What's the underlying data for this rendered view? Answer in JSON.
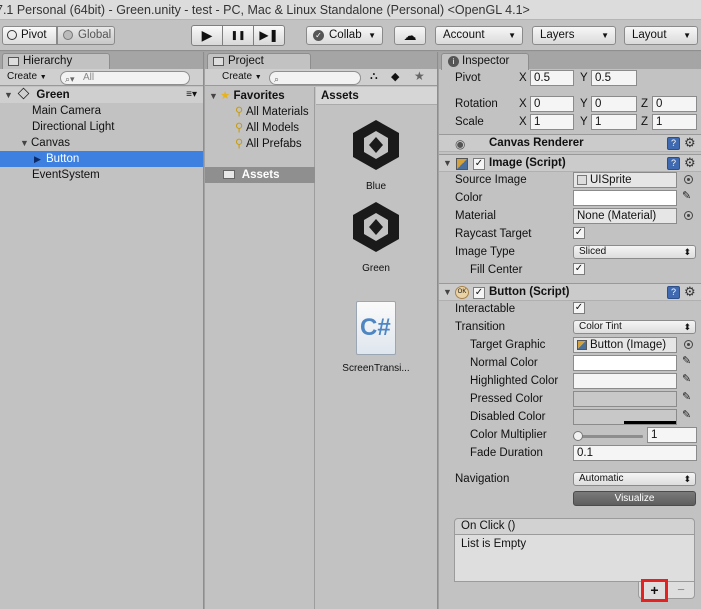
{
  "window": {
    "title": "7.1 Personal (64bit) - Green.unity - test - PC, Mac & Linux Standalone (Personal) <OpenGL 4.1>"
  },
  "toolbar": {
    "pivot": "Pivot",
    "global": "Global",
    "play": "▶",
    "pause": "❚❚",
    "step": "▶❚",
    "collab": "Collab",
    "cloud": "☁",
    "account": "Account",
    "layers": "Layers",
    "layout": "Layout"
  },
  "hierarchy": {
    "tab": "Hierarchy",
    "create": "Create",
    "search_placeholder": "All",
    "scene": "Green",
    "items": [
      {
        "label": "Main Camera"
      },
      {
        "label": "Directional Light"
      },
      {
        "label": "Canvas"
      },
      {
        "label": "Button"
      },
      {
        "label": "EventSystem"
      }
    ]
  },
  "project": {
    "tab": "Project",
    "create": "Create",
    "favorites": "Favorites",
    "fav_items": [
      "All Materials",
      "All Models",
      "All Prefabs"
    ],
    "assets_folder": "Assets",
    "assets_header": "Assets",
    "assets": [
      {
        "label": "Blue",
        "icon": "unity-logo-icon"
      },
      {
        "label": "Green",
        "icon": "unity-logo-icon"
      },
      {
        "label": "ScreenTransi...",
        "icon": "csharp-script-icon"
      }
    ]
  },
  "inspector": {
    "tab": "Inspector",
    "pivot": {
      "label": "Pivot",
      "x": "0.5",
      "y": "0.5"
    },
    "rotation": {
      "label": "Rotation",
      "x": "0",
      "y": "0",
      "z": "0"
    },
    "scale": {
      "label": "Scale",
      "x": "1",
      "y": "1",
      "z": "1"
    },
    "axis": {
      "x": "X",
      "y": "Y",
      "z": "Z"
    },
    "canvas_renderer": "Canvas Renderer",
    "image": {
      "title": "Image (Script)",
      "source_image_label": "Source Image",
      "source_image_value": "UISprite",
      "color_label": "Color",
      "material_label": "Material",
      "material_value": "None (Material)",
      "raycast_label": "Raycast Target",
      "image_type_label": "Image Type",
      "image_type_value": "Sliced",
      "fill_center_label": "Fill Center"
    },
    "button": {
      "title": "Button (Script)",
      "interactable_label": "Interactable",
      "transition_label": "Transition",
      "transition_value": "Color Tint",
      "target_graphic_label": "Target Graphic",
      "target_graphic_value": "Button (Image)",
      "normal_color_label": "Normal Color",
      "highlighted_color_label": "Highlighted Color",
      "pressed_color_label": "Pressed Color",
      "disabled_color_label": "Disabled Color",
      "color_multiplier_label": "Color Multiplier",
      "color_multiplier_value": "1",
      "fade_duration_label": "Fade Duration",
      "fade_duration_value": "0.1",
      "navigation_label": "Navigation",
      "navigation_value": "Automatic",
      "visualize": "Visualize",
      "onclick_header": "On Click ()",
      "onclick_empty": "List is Empty",
      "add": "+",
      "remove": "−"
    }
  },
  "colors": {
    "selection": "#3d80df",
    "highlight_box": "#e52222"
  }
}
